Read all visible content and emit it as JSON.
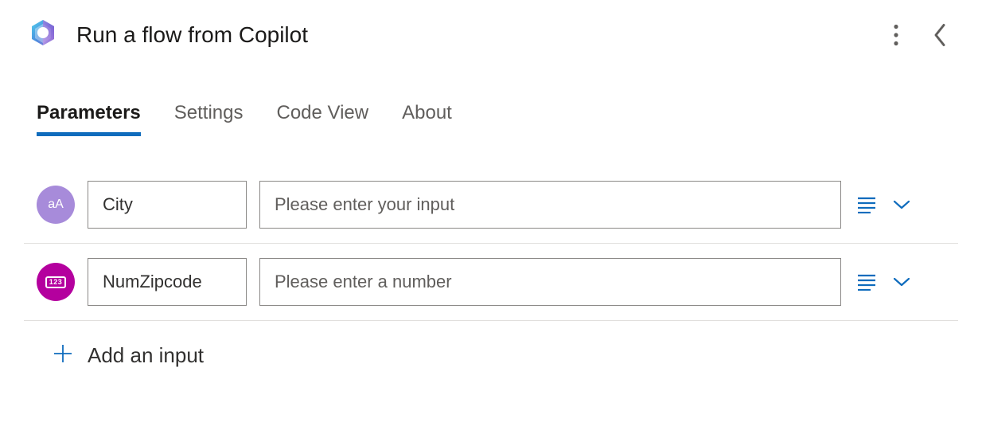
{
  "header": {
    "title": "Run a flow from Copilot"
  },
  "tabs": [
    {
      "label": "Parameters",
      "active": true
    },
    {
      "label": "Settings",
      "active": false
    },
    {
      "label": "Code View",
      "active": false
    },
    {
      "label": "About",
      "active": false
    }
  ],
  "parameters": [
    {
      "icon": "text-type-icon",
      "iconGlyph": "aA",
      "iconClass": "type-text",
      "name": "City",
      "placeholder": "Please enter your input",
      "value": ""
    },
    {
      "icon": "number-type-icon",
      "iconGlyph": "123",
      "iconClass": "type-number",
      "name": "NumZipcode",
      "placeholder": "Please enter a number",
      "value": ""
    }
  ],
  "addInput": {
    "label": "Add an input"
  }
}
